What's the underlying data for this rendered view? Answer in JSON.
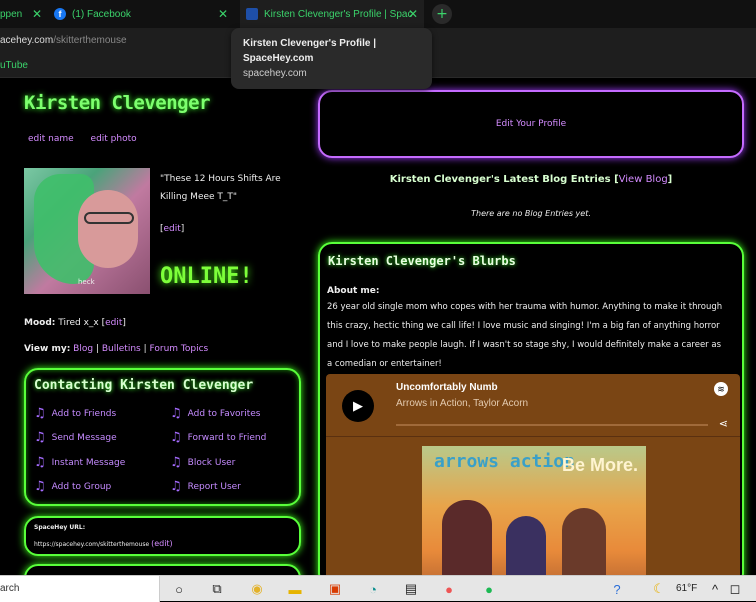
{
  "browser": {
    "tabs": [
      {
        "label": "ppen"
      },
      {
        "label": "(1) Facebook"
      },
      {
        "label": "Kirsten Clevenger's Profile | Spac"
      }
    ],
    "url_domain": "acehey.com",
    "url_path": "/skitterthemouse",
    "bookmark": "uTube",
    "tooltip": {
      "title": "Kirsten Clevenger's Profile | SpaceHey.com",
      "url": "spacehey.com"
    }
  },
  "profile": {
    "name": "Kirsten Clevenger",
    "edit_name": "edit name",
    "edit_photo": "edit photo",
    "avatar_tag": "heck",
    "status_quote": "\"These 12 Hours Shifts Are Killing Meee T_T\"",
    "status_edit_open": "[",
    "status_edit_link": "edit",
    "status_edit_close": "]",
    "online": "ONLINE!",
    "mood_label": "Mood:",
    "mood_value": "Tired x_x [",
    "mood_edit": "edit",
    "mood_close": "]",
    "view_my_label": "View my:",
    "view_links": [
      "Blog",
      "Bulletins",
      "Forum Topics"
    ],
    "view_sep": "|"
  },
  "contact": {
    "title": "Contacting Kirsten Clevenger",
    "left": [
      "Add to Friends",
      "Send Message",
      "Instant Message",
      "Add to Group"
    ],
    "right": [
      "Add to Favorites",
      "Forward to Friend",
      "Block User",
      "Report User"
    ]
  },
  "spacehey_url": {
    "label": "SpaceHey URL:",
    "value": "https://spacehey.com/skitterthemouse",
    "edit": "(edit)"
  },
  "main": {
    "edit_profile": "Edit Your Profile",
    "blog_heading": "Kirsten Clevenger's Latest Blog Entries",
    "blog_open": "[",
    "view_blog": "View Blog",
    "blog_close": "]",
    "no_blog": "There are no Blog Entries yet.",
    "blurbs_title": "Kirsten Clevenger's Blurbs",
    "about_label": "About me:",
    "about_text": "26 year old single mom who copes with her trauma with humor. Anything to make it through this crazy, hectic thing we call life! I love music and singing! I'm a big fan of anything horror and I love to make people laugh. If I wasn't so stage shy, I would definitely make a career as a comedian or entertainer!"
  },
  "spotify": {
    "song": "Uncomfortably Numb",
    "artist": "Arrows in Action, Taylor Acorn",
    "album_text_left": "arrows action",
    "album_text_right": "Be More.",
    "bg_color": "#7a4514"
  },
  "taskbar": {
    "search": "arch",
    "temperature": "61°F"
  }
}
